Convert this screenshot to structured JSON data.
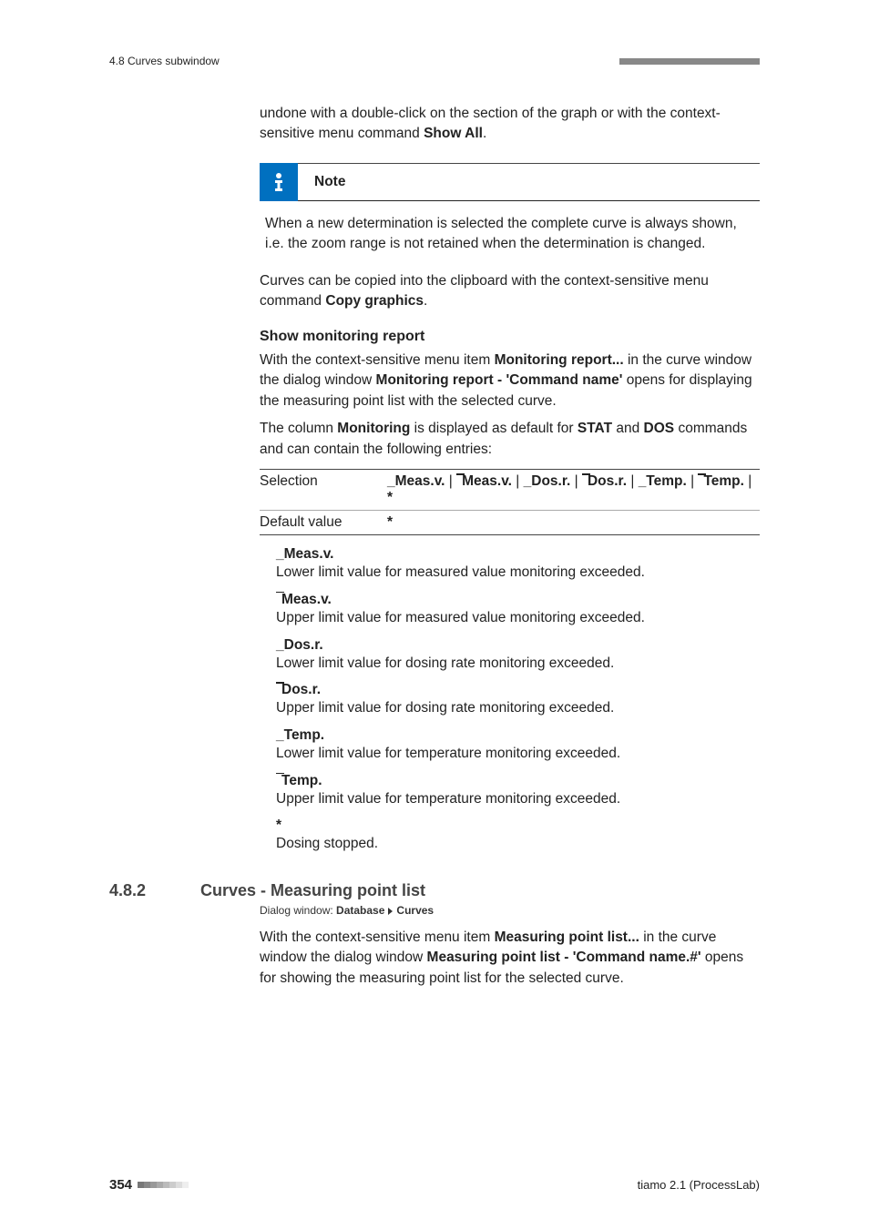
{
  "header": {
    "left": "4.8 Curves subwindow"
  },
  "body": {
    "para1_a": "undone with a double-click on the section of the graph or with the context-sensitive menu command ",
    "para1_b": "Show All",
    "para1_c": ".",
    "note_title": "Note",
    "note_body": "When a new determination is selected the complete curve is always shown, i.e. the zoom range is not retained when the determination is changed.",
    "para2_a": "Curves can be copied into the clipboard with the context-sensitive menu command ",
    "para2_b": "Copy graphics",
    "para2_c": ".",
    "section1_title": "Show monitoring report",
    "s1p1_a": "With the context-sensitive menu item ",
    "s1p1_b": "Monitoring report...",
    "s1p1_c": " in the curve window the dialog window ",
    "s1p1_d": "Monitoring report - 'Command name'",
    "s1p1_e": " opens for displaying the measuring point list with the selected curve.",
    "s1p2_a": "The column ",
    "s1p2_b": "Monitoring",
    "s1p2_c": " is displayed as default for ",
    "s1p2_d": "STAT",
    "s1p2_e": " and ",
    "s1p2_f": "DOS",
    "s1p2_g": " commands and can contain the following entries:",
    "table": {
      "r1k": "Selection",
      "r1v_parts": [
        {
          "t": "_Meas.v.",
          "over": false
        },
        " | ",
        {
          "t": "Meas.v.",
          "over": true
        },
        " | ",
        {
          "t": "_Dos.r.",
          "over": false
        },
        " | ",
        {
          "t": "Dos.r.",
          "over": true
        },
        " | ",
        {
          "t": "_Temp.",
          "over": false
        },
        " | ",
        {
          "t": "Temp.",
          "over": true
        },
        " | ",
        {
          "t": "*",
          "over": false
        }
      ],
      "r2k": "Default value",
      "r2v": "*"
    },
    "enum": [
      {
        "term": "_Meas.v.",
        "over": false,
        "desc": "Lower limit value for measured value monitoring exceeded."
      },
      {
        "term": "Meas.v.",
        "over": true,
        "desc": "Upper limit value for measured value monitoring exceeded."
      },
      {
        "term": "_Dos.r.",
        "over": false,
        "desc": "Lower limit value for dosing rate monitoring exceeded."
      },
      {
        "term": "Dos.r.",
        "over": true,
        "desc": "Upper limit value for dosing rate monitoring exceeded."
      },
      {
        "term": "_Temp.",
        "over": false,
        "desc": "Lower limit value for temperature monitoring exceeded."
      },
      {
        "term": "Temp.",
        "over": true,
        "desc": "Upper limit value for temperature monitoring exceeded."
      },
      {
        "term": "*",
        "over": false,
        "desc": "Dosing stopped."
      }
    ],
    "h2_num": "4.8.2",
    "h2_title": "Curves - Measuring point list",
    "dialog_prefix": "Dialog window: ",
    "dialog_a": "Database",
    "dialog_b": "Curves",
    "s2p1_a": "With the context-sensitive menu item ",
    "s2p1_b": "Measuring point list...",
    "s2p1_c": " in the curve window the dialog window ",
    "s2p1_d": "Measuring point list - 'Command name.#'",
    "s2p1_e": " opens for showing the measuring point list for the selected curve."
  },
  "footer": {
    "page": "354",
    "right": "tiamo 2.1 (ProcessLab)"
  }
}
